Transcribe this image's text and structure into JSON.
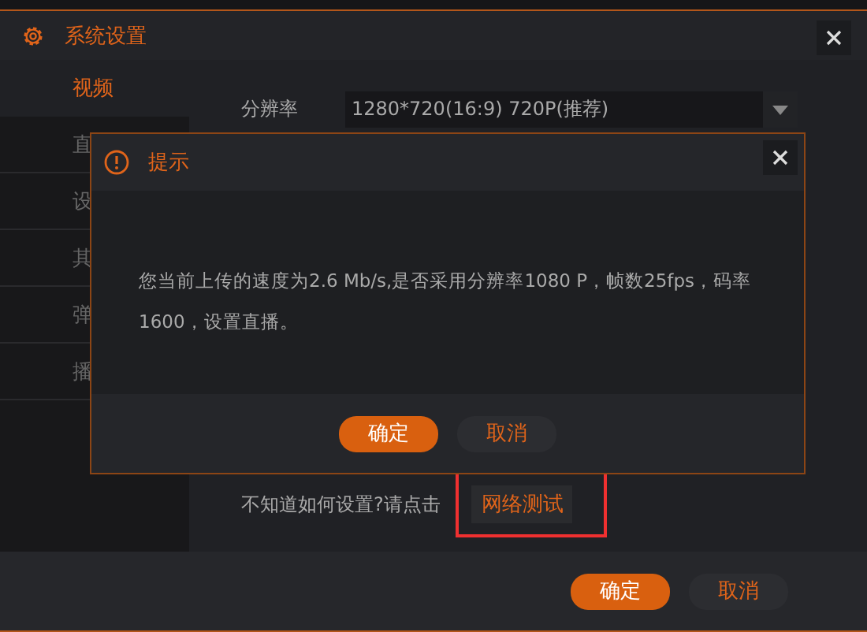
{
  "window": {
    "title": "系统设置"
  },
  "sidebar": {
    "items": [
      {
        "label": "视频",
        "selected": true
      },
      {
        "label": "直",
        "selected": false
      },
      {
        "label": "设",
        "selected": false
      },
      {
        "label": "其",
        "selected": false
      },
      {
        "label": "弹",
        "selected": false
      },
      {
        "label": "播",
        "selected": false
      }
    ]
  },
  "settings": {
    "resolution_label": "分辨率",
    "resolution_value": "1280*720(16:9) 720P(推荐)",
    "help_text": "不知道如何设置?请点击",
    "network_test_button": "网络测试"
  },
  "footer": {
    "buttons": [
      {
        "label": "确定",
        "kind": "primary"
      },
      {
        "label": "取消",
        "kind": "secondary"
      }
    ]
  },
  "dialog": {
    "title": "提示",
    "message": "您当前上传的速度为2.6 Mb/s,是否采用分辨率1080 P，帧数25fps，码率1600，设置直播。",
    "buttons": [
      {
        "label": "确定",
        "kind": "primary"
      },
      {
        "label": "取消",
        "kind": "secondary"
      }
    ]
  }
}
